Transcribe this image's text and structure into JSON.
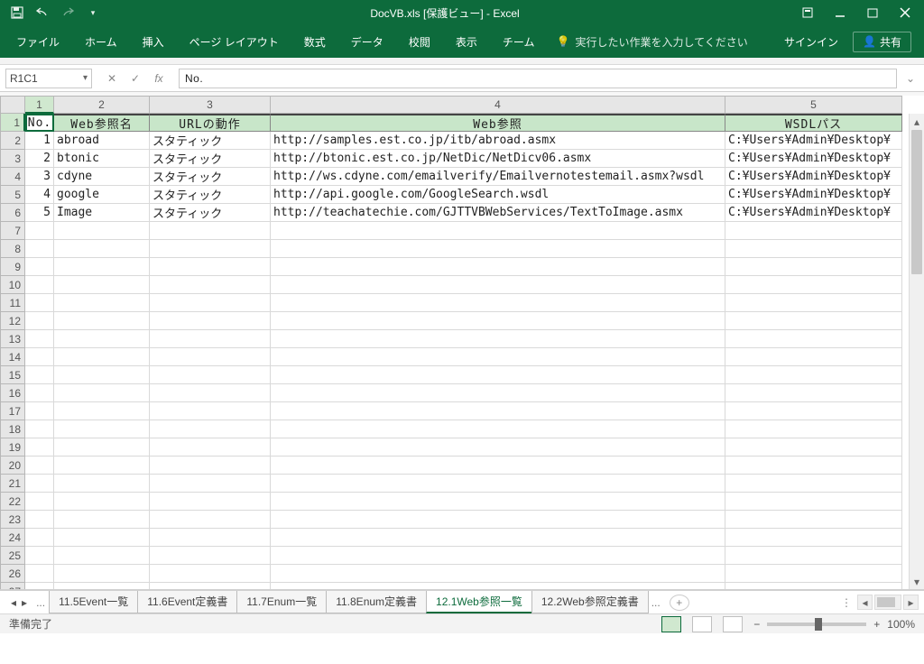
{
  "title": "DocVB.xls  [保護ビュー] - Excel",
  "qat_icons": [
    "save-icon",
    "undo-icon",
    "redo-icon",
    "customize-icon"
  ],
  "window_buttons": [
    "ribbon-options-icon",
    "minimize-icon",
    "maximize-icon",
    "close-icon"
  ],
  "ribbon": {
    "tabs": [
      "ファイル",
      "ホーム",
      "挿入",
      "ページ レイアウト",
      "数式",
      "データ",
      "校閲",
      "表示",
      "チーム"
    ],
    "tellme_placeholder": "実行したい作業を入力してください",
    "signin": "サインイン",
    "share": "共有"
  },
  "namebox": "R1C1",
  "formula": "No.",
  "columns": [
    "1",
    "2",
    "3",
    "4",
    "5"
  ],
  "headers": [
    "No.",
    "Web参照名",
    "URLの動作",
    "Web参照",
    "WSDLパス"
  ],
  "rows": [
    {
      "no": "1",
      "name": "abroad",
      "url_action": "スタティック",
      "web_ref": "http://samples.est.co.jp/itb/abroad.asmx",
      "wsdl": "C:¥Users¥Admin¥Desktop¥"
    },
    {
      "no": "2",
      "name": "btonic",
      "url_action": "スタティック",
      "web_ref": "http://btonic.est.co.jp/NetDic/NetDicv06.asmx",
      "wsdl": "C:¥Users¥Admin¥Desktop¥"
    },
    {
      "no": "3",
      "name": "cdyne",
      "url_action": "スタティック",
      "web_ref": "http://ws.cdyne.com/emailverify/Emailvernotestemail.asmx?wsdl",
      "wsdl": "C:¥Users¥Admin¥Desktop¥"
    },
    {
      "no": "4",
      "name": "google",
      "url_action": "スタティック",
      "web_ref": "http://api.google.com/GoogleSearch.wsdl",
      "wsdl": "C:¥Users¥Admin¥Desktop¥"
    },
    {
      "no": "5",
      "name": "Image",
      "url_action": "スタティック",
      "web_ref": "http://teachatechie.com/GJTTVBWebServices/TextToImage.asmx",
      "wsdl": "C:¥Users¥Admin¥Desktop¥"
    }
  ],
  "empty_rows_start": 7,
  "empty_rows_end": 27,
  "sheet_tabs": [
    "11.5Event一覧",
    "11.6Event定義書",
    "11.7Enum一覧",
    "11.8Enum定義書",
    "12.1Web参照一覧",
    "12.2Web参照定義書"
  ],
  "active_sheet_index": 4,
  "trailing_dots": "...",
  "status_text": "準備完了",
  "zoom": "100%"
}
